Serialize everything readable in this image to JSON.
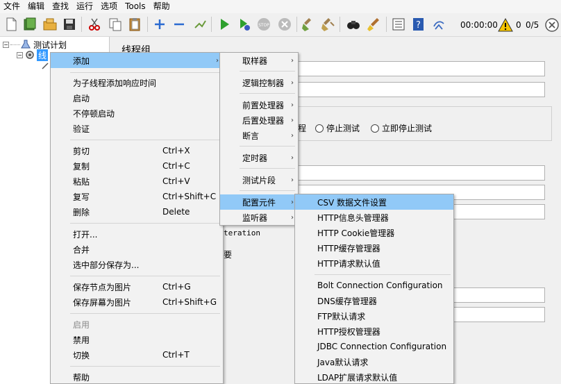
{
  "menubar": {
    "items": [
      "文件",
      "编辑",
      "查找",
      "运行",
      "选项",
      "Tools",
      "帮助"
    ]
  },
  "toolbar": {
    "icons": [
      "new-icon",
      "templates-icon",
      "open-icon",
      "save-icon",
      "cut-icon",
      "copy-icon",
      "paste-icon",
      "expand-icon",
      "collapse-icon",
      "toggle-icon",
      "start-icon",
      "start-no-pause-icon",
      "stop-icon",
      "shutdown-icon",
      "clear-icon",
      "clear-all-icon",
      "search-icon",
      "reset-search-icon",
      "function-helper-icon",
      "help-icon",
      "remote-icon"
    ],
    "timer": "00:00:00",
    "warning_count": "0",
    "threads": "0/5"
  },
  "tree": {
    "root": "测试计划",
    "child": "线"
  },
  "right": {
    "title": "线程组",
    "radio_fragment": "程",
    "radio_stop_test": "停止测试",
    "radio_stop_now": "立即停止测试",
    "iteration_fragment": "teration",
    "fragment_2": "要"
  },
  "menu1": {
    "items": [
      {
        "label": "添加",
        "shortcut": "",
        "submenu": true
      },
      {
        "label": "为子线程添加响应时间",
        "shortcut": ""
      },
      {
        "label": "启动",
        "shortcut": ""
      },
      {
        "label": "不停顿启动",
        "shortcut": ""
      },
      {
        "label": "验证",
        "shortcut": ""
      },
      {
        "label": "剪切",
        "shortcut": "Ctrl+X"
      },
      {
        "label": "复制",
        "shortcut": "Ctrl+C"
      },
      {
        "label": "粘贴",
        "shortcut": "Ctrl+V"
      },
      {
        "label": "复写",
        "shortcut": "Ctrl+Shift+C"
      },
      {
        "label": "删除",
        "shortcut": "Delete"
      },
      {
        "label": "打开...",
        "shortcut": ""
      },
      {
        "label": "合并",
        "shortcut": ""
      },
      {
        "label": "选中部分保存为...",
        "shortcut": ""
      },
      {
        "label": "保存节点为图片",
        "shortcut": "Ctrl+G"
      },
      {
        "label": "保存屏幕为图片",
        "shortcut": "Ctrl+Shift+G"
      },
      {
        "label": "启用",
        "shortcut": "",
        "disabled": true
      },
      {
        "label": "禁用",
        "shortcut": ""
      },
      {
        "label": "切换",
        "shortcut": "Ctrl+T"
      },
      {
        "label": "帮助",
        "shortcut": ""
      }
    ]
  },
  "menu2": {
    "items": [
      {
        "label": "取样器"
      },
      {
        "label": "逻辑控制器"
      },
      {
        "label": "前置处理器"
      },
      {
        "label": "后置处理器"
      },
      {
        "label": "断言"
      },
      {
        "label": "定时器"
      },
      {
        "label": "测试片段"
      },
      {
        "label": "配置元件"
      },
      {
        "label": "监听器"
      }
    ]
  },
  "menu3": {
    "items": [
      "CSV 数据文件设置",
      "HTTP信息头管理器",
      "HTTP Cookie管理器",
      "HTTP缓存管理器",
      "HTTP请求默认值",
      "Bolt Connection Configuration",
      "DNS缓存管理器",
      "FTP默认请求",
      "HTTP授权管理器",
      "JDBC Connection Configuration",
      "Java默认请求",
      "LDAP扩展请求默认值"
    ]
  }
}
